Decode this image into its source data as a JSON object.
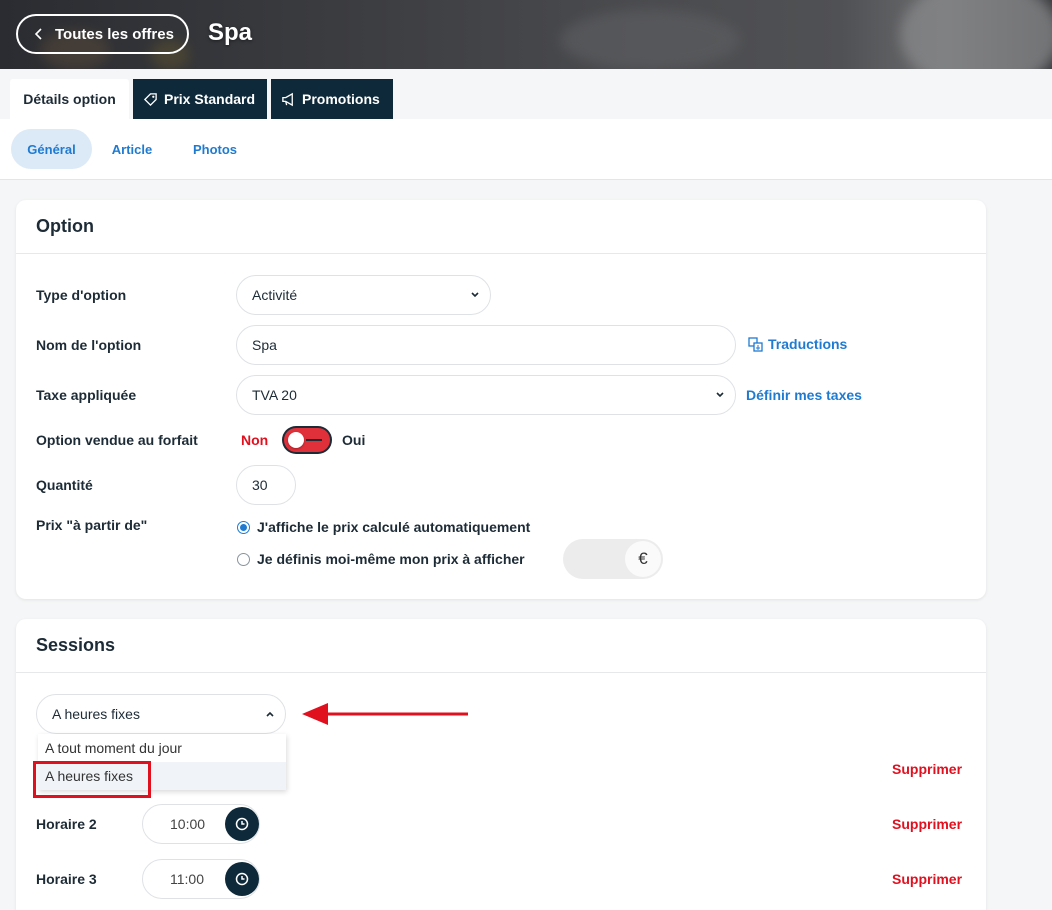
{
  "header": {
    "back_label": "Toutes les offres",
    "title": "Spa"
  },
  "main_tabs": [
    {
      "label": "Détails option",
      "icon": "none",
      "active": true
    },
    {
      "label": "Prix Standard",
      "icon": "tag-icon",
      "active": false
    },
    {
      "label": "Promotions",
      "icon": "megaphone-icon",
      "active": false
    }
  ],
  "sub_tabs": [
    {
      "label": "Général",
      "active": true
    },
    {
      "label": "Article",
      "active": false
    },
    {
      "label": "Photos",
      "active": false
    }
  ],
  "option_card": {
    "title": "Option",
    "type_label": "Type d'option",
    "type_value": "Activité",
    "name_label": "Nom de l'option",
    "name_value": "Spa",
    "translations_link": "Traductions",
    "tax_label": "Taxe appliquée",
    "tax_value": "TVA 20",
    "tax_link": "Définir mes taxes",
    "package_label": "Option vendue au forfait",
    "package_no": "Non",
    "package_yes": "Oui",
    "package_state": "Non",
    "quantity_label": "Quantité",
    "quantity_value": "30",
    "price_from_label": "Prix \"à partir de\"",
    "price_auto": "J'affiche le prix calculé automatiquement",
    "price_manual": "Je définis moi-même mon prix à afficher",
    "price_selected": "auto",
    "currency": "€"
  },
  "sessions_card": {
    "title": "Sessions",
    "mode_value": "A heures fixes",
    "dropdown_options": [
      "A tout moment du jour",
      "A heures fixes"
    ],
    "delete_label": "Supprimer",
    "schedules": [
      {
        "label": "Horaire 2",
        "time": "10:00"
      },
      {
        "label": "Horaire 3",
        "time": "11:00"
      }
    ]
  },
  "colors": {
    "accent": "#1f7bd1",
    "dark": "#0e2a3a",
    "danger": "#e1101f"
  }
}
